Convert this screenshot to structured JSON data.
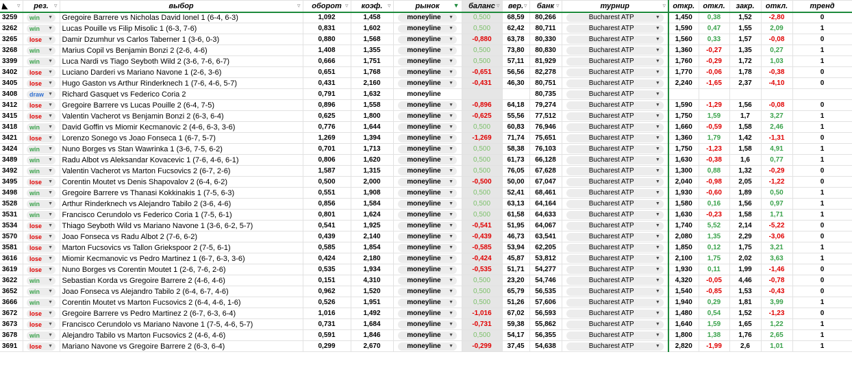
{
  "header": {
    "id": "",
    "res": "рез.",
    "choice": "выбор",
    "turnover": "оборот",
    "coef": "коэф.",
    "market": "рынок",
    "balance": "баланс",
    "prob": "вер.",
    "bank": "банк",
    "tournament": "турнир",
    "open": "откр.",
    "dev1": "откл.",
    "close": "закр.",
    "dev2": "откл.",
    "trend": "тренд"
  },
  "colors": {
    "accent": "#1e8a3c",
    "win": "#3aa24b",
    "lose": "#e00000",
    "draw": "#2f6fd0"
  },
  "rows": [
    {
      "id": "3259",
      "res": "win",
      "choice": "Gregoire Barrere vs Nicholas David Ionel 1 (6-4, 6-3)",
      "turnover": "1,092",
      "coef": "1,458",
      "market": "moneyline",
      "balance": "0,500",
      "prob": "68,59",
      "bank": "80,266",
      "tournament": "Bucharest ATP",
      "open": "1,450",
      "dev1": "0,38",
      "close": "1,52",
      "dev2": "-2,80",
      "trend": "0"
    },
    {
      "id": "3262",
      "res": "win",
      "choice": "Lucas Pouille vs Filip Misolic 1 (6-3, 7-6)",
      "turnover": "0,831",
      "coef": "1,602",
      "market": "moneyline",
      "balance": "0,500",
      "prob": "62,42",
      "bank": "80,711",
      "tournament": "Bucharest ATP",
      "open": "1,590",
      "dev1": "0,47",
      "close": "1,55",
      "dev2": "2,09",
      "trend": "1"
    },
    {
      "id": "3265",
      "res": "lose",
      "choice": "Damir Dzumhur vs Carlos Taberner 1 (3-6, 0-3)",
      "turnover": "0,880",
      "coef": "1,568",
      "market": "moneyline",
      "balance": "-0,880",
      "prob": "63,78",
      "bank": "80,330",
      "tournament": "Bucharest ATP",
      "open": "1,560",
      "dev1": "0,33",
      "close": "1,57",
      "dev2": "-0,08",
      "trend": "0"
    },
    {
      "id": "3268",
      "res": "win",
      "choice": "Marius Copil vs Benjamin Bonzi 2 (2-6, 4-6)",
      "turnover": "1,408",
      "coef": "1,355",
      "market": "moneyline",
      "balance": "0,500",
      "prob": "73,80",
      "bank": "80,830",
      "tournament": "Bucharest ATP",
      "open": "1,360",
      "dev1": "-0,27",
      "close": "1,35",
      "dev2": "0,27",
      "trend": "1"
    },
    {
      "id": "3399",
      "res": "win",
      "choice": "Luca Nardi vs Tiago Seyboth Wild 2 (3-6, 7-6, 6-7)",
      "turnover": "0,666",
      "coef": "1,751",
      "market": "moneyline",
      "balance": "0,500",
      "prob": "57,11",
      "bank": "81,929",
      "tournament": "Bucharest ATP",
      "open": "1,760",
      "dev1": "-0,29",
      "close": "1,72",
      "dev2": "1,03",
      "trend": "1"
    },
    {
      "id": "3402",
      "res": "lose",
      "choice": "Luciano Darderi vs Mariano Navone 1 (2-6, 3-6)",
      "turnover": "0,651",
      "coef": "1,768",
      "market": "moneyline",
      "balance": "-0,651",
      "prob": "56,56",
      "bank": "82,278",
      "tournament": "Bucharest ATP",
      "open": "1,770",
      "dev1": "-0,06",
      "close": "1,78",
      "dev2": "-0,38",
      "trend": "0"
    },
    {
      "id": "3405",
      "res": "lose",
      "choice": "Hugo Gaston vs Arthur Rinderknech 1 (7-6, 4-6, 5-7)",
      "turnover": "0,431",
      "coef": "2,160",
      "market": "moneyline",
      "balance": "-0,431",
      "prob": "46,30",
      "bank": "80,751",
      "tournament": "Bucharest ATP",
      "open": "2,240",
      "dev1": "-1,65",
      "close": "2,37",
      "dev2": "-4,10",
      "trend": "0"
    },
    {
      "id": "3408",
      "res": "draw",
      "choice": "Richard Gasquet vs Federico Coria 2",
      "turnover": "0,791",
      "coef": "1,632",
      "market": "moneyline",
      "balance": "",
      "prob": "",
      "bank": "80,735",
      "tournament": "Bucharest ATP",
      "open": "",
      "dev1": "",
      "close": "",
      "dev2": "",
      "trend": ""
    },
    {
      "id": "3412",
      "res": "lose",
      "choice": "Gregoire Barrere vs Lucas Pouille 2 (6-4, 7-5)",
      "turnover": "0,896",
      "coef": "1,558",
      "market": "moneyline",
      "balance": "-0,896",
      "prob": "64,18",
      "bank": "79,274",
      "tournament": "Bucharest ATP",
      "open": "1,590",
      "dev1": "-1,29",
      "close": "1,56",
      "dev2": "-0,08",
      "trend": "0"
    },
    {
      "id": "3415",
      "res": "lose",
      "choice": "Valentin Vacherot vs Benjamin Bonzi 2 (6-3, 6-4)",
      "turnover": "0,625",
      "coef": "1,800",
      "market": "moneyline",
      "balance": "-0,625",
      "prob": "55,56",
      "bank": "77,512",
      "tournament": "Bucharest ATP",
      "open": "1,750",
      "dev1": "1,59",
      "close": "1,7",
      "dev2": "3,27",
      "trend": "1"
    },
    {
      "id": "3418",
      "res": "win",
      "choice": "David Goffin vs Miomir Kecmanovic 2 (4-6, 6-3, 3-6)",
      "turnover": "0,776",
      "coef": "1,644",
      "market": "moneyline",
      "balance": "0,500",
      "prob": "60,83",
      "bank": "76,946",
      "tournament": "Bucharest ATP",
      "open": "1,660",
      "dev1": "-0,59",
      "close": "1,58",
      "dev2": "2,46",
      "trend": "1"
    },
    {
      "id": "3421",
      "res": "lose",
      "choice": "Lorenzo Sonego vs Joao Fonseca 1 (6-7, 5-7)",
      "turnover": "1,269",
      "coef": "1,394",
      "market": "moneyline",
      "balance": "-1,269",
      "prob": "71,74",
      "bank": "75,651",
      "tournament": "Bucharest ATP",
      "open": "1,360",
      "dev1": "1,79",
      "close": "1,42",
      "dev2": "-1,31",
      "trend": "0"
    },
    {
      "id": "3424",
      "res": "win",
      "choice": "Nuno Borges vs Stan Wawrinka 1 (3-6, 7-5, 6-2)",
      "turnover": "0,701",
      "coef": "1,713",
      "market": "moneyline",
      "balance": "0,500",
      "prob": "58,38",
      "bank": "76,103",
      "tournament": "Bucharest ATP",
      "open": "1,750",
      "dev1": "-1,23",
      "close": "1,58",
      "dev2": "4,91",
      "trend": "1"
    },
    {
      "id": "3489",
      "res": "win",
      "choice": "Radu Albot vs Aleksandar Kovacevic 1 (7-6, 4-6, 6-1)",
      "turnover": "0,806",
      "coef": "1,620",
      "market": "moneyline",
      "balance": "0,500",
      "prob": "61,73",
      "bank": "66,128",
      "tournament": "Bucharest ATP",
      "open": "1,630",
      "dev1": "-0,38",
      "close": "1,6",
      "dev2": "0,77",
      "trend": "1"
    },
    {
      "id": "3492",
      "res": "win",
      "choice": "Valentin Vacherot vs Marton Fucsovics 2 (6-7, 2-6)",
      "turnover": "1,587",
      "coef": "1,315",
      "market": "moneyline",
      "balance": "0,500",
      "prob": "76,05",
      "bank": "67,628",
      "tournament": "Bucharest ATP",
      "open": "1,300",
      "dev1": "0,88",
      "close": "1,32",
      "dev2": "-0,29",
      "trend": "0"
    },
    {
      "id": "3495",
      "res": "lose",
      "choice": "Corentin Moutet vs Denis Shapovalov 2 (6-4, 6-2)",
      "turnover": "0,500",
      "coef": "2,000",
      "market": "moneyline",
      "balance": "-0,500",
      "prob": "50,00",
      "bank": "67,047",
      "tournament": "Bucharest ATP",
      "open": "2,040",
      "dev1": "-0,98",
      "close": "2,05",
      "dev2": "-1,22",
      "trend": "0"
    },
    {
      "id": "3498",
      "res": "win",
      "choice": "Gregoire Barrere vs Thanasi Kokkinakis 1 (7-5, 6-3)",
      "turnover": "0,551",
      "coef": "1,908",
      "market": "moneyline",
      "balance": "0,500",
      "prob": "52,41",
      "bank": "68,461",
      "tournament": "Bucharest ATP",
      "open": "1,930",
      "dev1": "-0,60",
      "close": "1,89",
      "dev2": "0,50",
      "trend": "1"
    },
    {
      "id": "3528",
      "res": "win",
      "choice": "Arthur Rinderknech vs Alejandro Tabilo 2 (3-6, 4-6)",
      "turnover": "0,856",
      "coef": "1,584",
      "market": "moneyline",
      "balance": "0,500",
      "prob": "63,13",
      "bank": "64,164",
      "tournament": "Bucharest ATP",
      "open": "1,580",
      "dev1": "0,16",
      "close": "1,56",
      "dev2": "0,97",
      "trend": "1"
    },
    {
      "id": "3531",
      "res": "win",
      "choice": "Francisco Cerundolo vs Federico Coria 1 (7-5, 6-1)",
      "turnover": "0,801",
      "coef": "1,624",
      "market": "moneyline",
      "balance": "0,500",
      "prob": "61,58",
      "bank": "64,633",
      "tournament": "Bucharest ATP",
      "open": "1,630",
      "dev1": "-0,23",
      "close": "1,58",
      "dev2": "1,71",
      "trend": "1"
    },
    {
      "id": "3534",
      "res": "lose",
      "choice": "Thiago Seyboth Wild vs Mariano Navone 1 (3-6, 6-2, 5-7)",
      "turnover": "0,541",
      "coef": "1,925",
      "market": "moneyline",
      "balance": "-0,541",
      "prob": "51,95",
      "bank": "64,067",
      "tournament": "Bucharest ATP",
      "open": "1,740",
      "dev1": "5,52",
      "close": "2,14",
      "dev2": "-5,22",
      "trend": "0"
    },
    {
      "id": "3570",
      "res": "lose",
      "choice": "Joao Fonseca vs Radu Albot 2 (7-6, 6-2)",
      "turnover": "0,439",
      "coef": "2,140",
      "market": "moneyline",
      "balance": "-0,439",
      "prob": "46,73",
      "bank": "63,541",
      "tournament": "Bucharest ATP",
      "open": "2,080",
      "dev1": "1,35",
      "close": "2,29",
      "dev2": "-3,06",
      "trend": "0"
    },
    {
      "id": "3581",
      "res": "lose",
      "choice": "Marton Fucsovics vs Tallon Griekspoor 2 (7-5, 6-1)",
      "turnover": "0,585",
      "coef": "1,854",
      "market": "moneyline",
      "balance": "-0,585",
      "prob": "53,94",
      "bank": "62,205",
      "tournament": "Bucharest ATP",
      "open": "1,850",
      "dev1": "0,12",
      "close": "1,75",
      "dev2": "3,21",
      "trend": "1"
    },
    {
      "id": "3616",
      "res": "lose",
      "choice": "Miomir Kecmanovic vs Pedro Martinez 1 (6-7, 6-3, 3-6)",
      "turnover": "0,424",
      "coef": "2,180",
      "market": "moneyline",
      "balance": "-0,424",
      "prob": "45,87",
      "bank": "53,812",
      "tournament": "Bucharest ATP",
      "open": "2,100",
      "dev1": "1,75",
      "close": "2,02",
      "dev2": "3,63",
      "trend": "1"
    },
    {
      "id": "3619",
      "res": "lose",
      "choice": "Nuno Borges vs Corentin Moutet 1 (2-6, 7-6, 2-6)",
      "turnover": "0,535",
      "coef": "1,934",
      "market": "moneyline",
      "balance": "-0,535",
      "prob": "51,71",
      "bank": "54,277",
      "tournament": "Bucharest ATP",
      "open": "1,930",
      "dev1": "0,11",
      "close": "1,99",
      "dev2": "-1,46",
      "trend": "0"
    },
    {
      "id": "3622",
      "res": "win",
      "choice": "Sebastian Korda vs Gregoire Barrere 2 (4-6, 4-6)",
      "turnover": "0,151",
      "coef": "4,310",
      "market": "moneyline",
      "balance": "0,500",
      "prob": "23,20",
      "bank": "54,746",
      "tournament": "Bucharest ATP",
      "open": "4,320",
      "dev1": "-0,05",
      "close": "4,46",
      "dev2": "-0,78",
      "trend": "0"
    },
    {
      "id": "3652",
      "res": "win",
      "choice": "Joao Fonseca vs Alejandro Tabilo 2 (6-4, 6-7, 4-6)",
      "turnover": "0,962",
      "coef": "1,520",
      "market": "moneyline",
      "balance": "0,500",
      "prob": "65,79",
      "bank": "56,535",
      "tournament": "Bucharest ATP",
      "open": "1,540",
      "dev1": "-0,85",
      "close": "1,53",
      "dev2": "-0,43",
      "trend": "0"
    },
    {
      "id": "3666",
      "res": "win",
      "choice": "Corentin Moutet vs Marton Fucsovics 2 (6-4, 4-6, 1-6)",
      "turnover": "0,526",
      "coef": "1,951",
      "market": "moneyline",
      "balance": "0,500",
      "prob": "51,26",
      "bank": "57,606",
      "tournament": "Bucharest ATP",
      "open": "1,940",
      "dev1": "0,29",
      "close": "1,81",
      "dev2": "3,99",
      "trend": "1"
    },
    {
      "id": "3672",
      "res": "lose",
      "choice": "Gregoire Barrere vs Pedro Martinez 2 (6-7, 6-3, 6-4)",
      "turnover": "1,016",
      "coef": "1,492",
      "market": "moneyline",
      "balance": "-1,016",
      "prob": "67,02",
      "bank": "56,593",
      "tournament": "Bucharest ATP",
      "open": "1,480",
      "dev1": "0,54",
      "close": "1,52",
      "dev2": "-1,23",
      "trend": "0"
    },
    {
      "id": "3673",
      "res": "lose",
      "choice": "Francisco Cerundolo vs Mariano Navone 1 (7-5, 4-6, 5-7)",
      "turnover": "0,731",
      "coef": "1,684",
      "market": "moneyline",
      "balance": "-0,731",
      "prob": "59,38",
      "bank": "55,862",
      "tournament": "Bucharest ATP",
      "open": "1,640",
      "dev1": "1,59",
      "close": "1,65",
      "dev2": "1,22",
      "trend": "1"
    },
    {
      "id": "3678",
      "res": "win",
      "choice": "Alejandro Tabilo vs Marton Fucsovics 2 (4-6, 4-6)",
      "turnover": "0,591",
      "coef": "1,846",
      "market": "moneyline",
      "balance": "0,500",
      "prob": "54,17",
      "bank": "56,355",
      "tournament": "Bucharest ATP",
      "open": "1,800",
      "dev1": "1,38",
      "close": "1,76",
      "dev2": "2,65",
      "trend": "1"
    },
    {
      "id": "3691",
      "res": "lose",
      "choice": "Mariano Navone vs Gregoire Barrere 2 (6-3, 6-4)",
      "turnover": "0,299",
      "coef": "2,670",
      "market": "moneyline",
      "balance": "-0,299",
      "prob": "37,45",
      "bank": "54,638",
      "tournament": "Bucharest ATP",
      "open": "2,820",
      "dev1": "-1,99",
      "close": "2,6",
      "dev2": "1,01",
      "trend": "1"
    }
  ]
}
